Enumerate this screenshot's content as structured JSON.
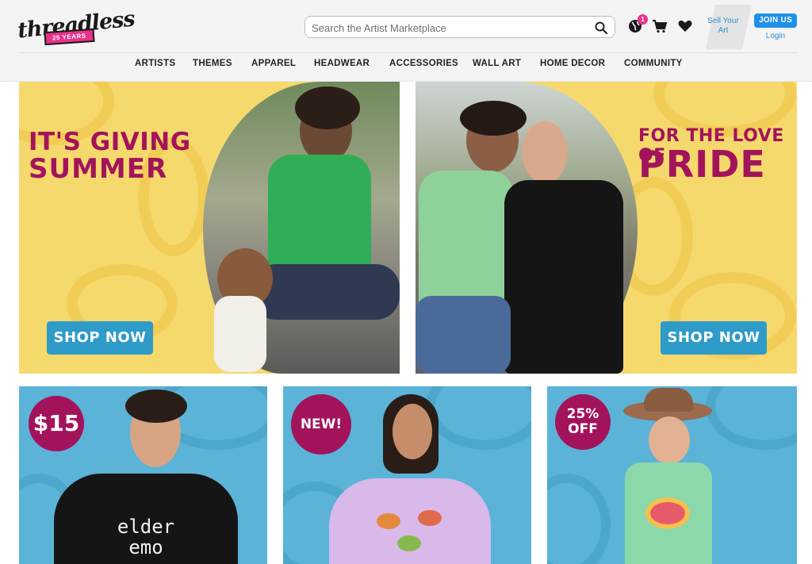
{
  "header": {
    "logo": {
      "wordmark": "threadless",
      "badge": "25 YEARS"
    },
    "search": {
      "placeholder": "Search the Artist Marketplace"
    },
    "icons": {
      "globe": "globe-icon",
      "cart": "cart-icon",
      "wishlist": "heart-icon",
      "search": "search-icon"
    },
    "notification_count": "1",
    "sell_link": "Sell Your Art",
    "join_button": "JOIN US",
    "login_link": "Login",
    "accent_color": "#1e90e8",
    "badge_color": "#e9328a"
  },
  "nav": {
    "items": [
      "ARTISTS",
      "THEMES",
      "APPAREL",
      "HEADWEAR",
      "ACCESSORIES",
      "WALL ART",
      "HOME DECOR",
      "COMMUNITY"
    ]
  },
  "hero": {
    "left": {
      "title_top": "IT'S GIVING",
      "title_bottom": "SUMMER",
      "button": "SHOP NOW"
    },
    "right": {
      "title_top": "FOR THE LOVE OF",
      "title_bottom": "PRIDE",
      "button": "SHOP NOW"
    },
    "background_color": "#f6d96d",
    "title_color": "#a3135c",
    "button_color": "#2e9bc9"
  },
  "tiles": [
    {
      "badge": "$15",
      "tee_text_line1": "elder",
      "tee_text_line2": "emo"
    },
    {
      "badge": "NEW!"
    },
    {
      "badge_line1": "25%",
      "badge_line2": "OFF"
    }
  ],
  "tile_colors": {
    "background": "#5bb3d8",
    "badge": "#a3135c"
  }
}
